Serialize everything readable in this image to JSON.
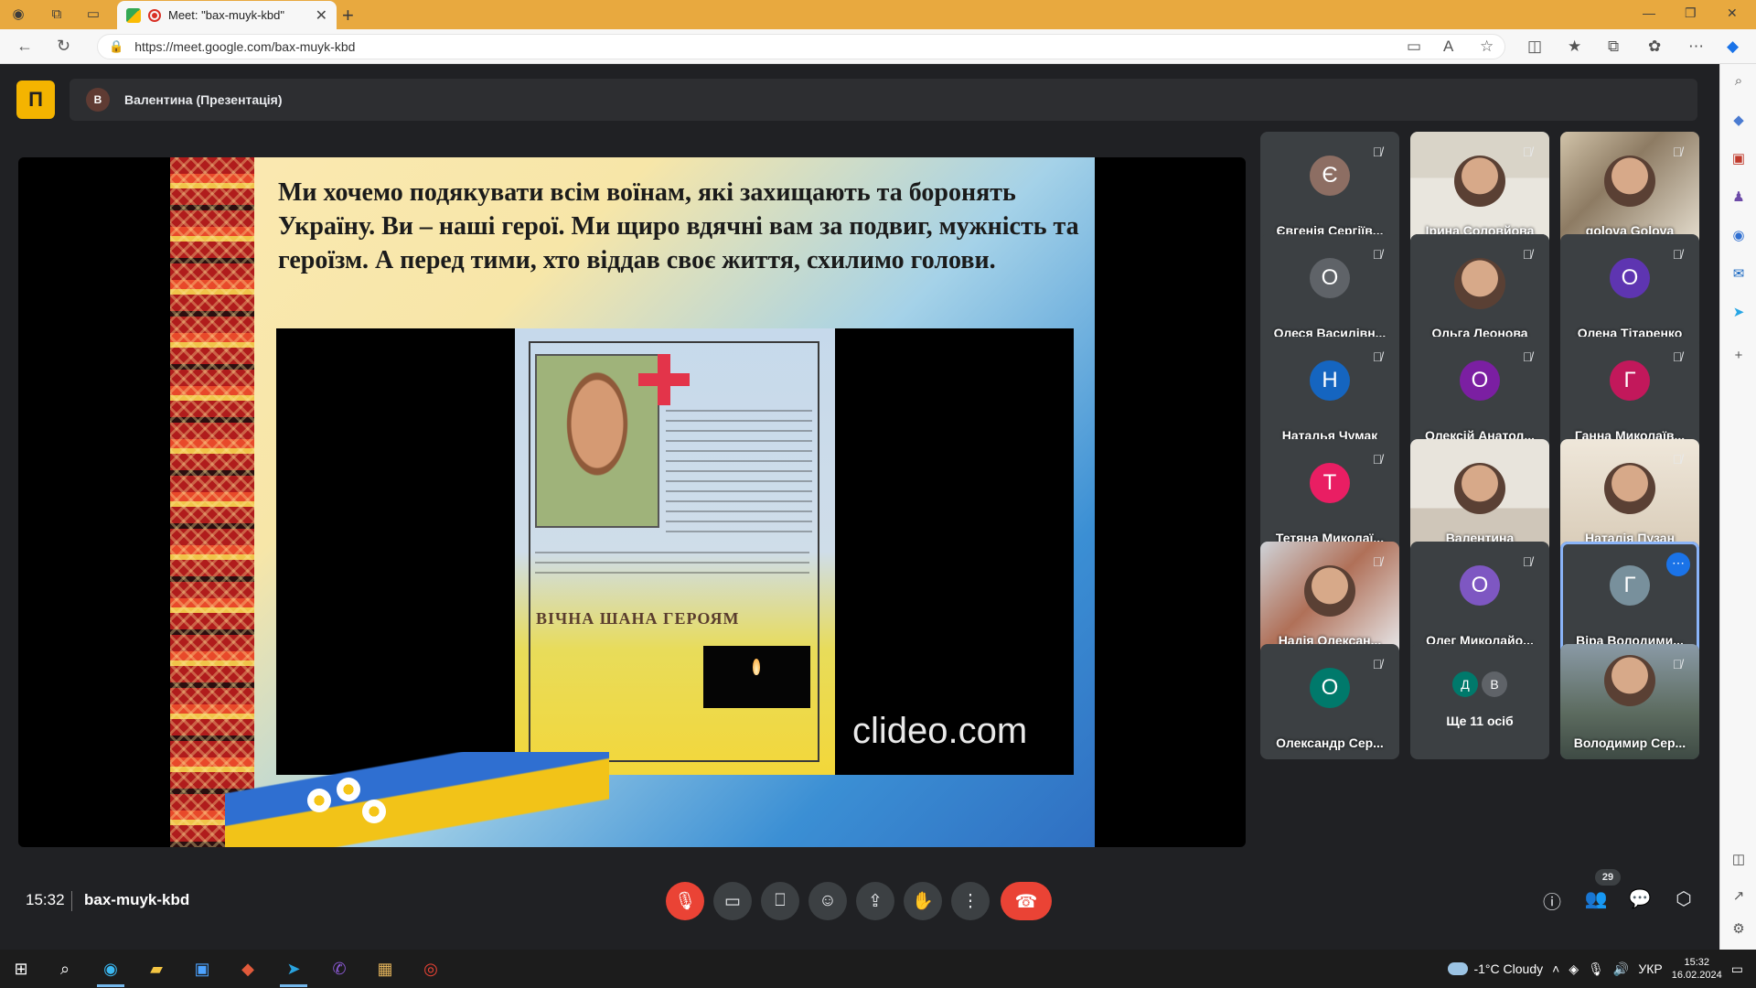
{
  "browser": {
    "tab_title": "Meet: \"bax-muyk-kbd\"",
    "url": "https://meet.google.com/bax-muyk-kbd"
  },
  "meet": {
    "presenter_initial": "В",
    "presenter_label": "Валентина (Презентація)",
    "slide": {
      "text": "Ми хочемо подякувати всім воїнам, які захищають та боронять Україну. Ви – наші герої. Ми щиро вдячні вам за подвиг, мужність та героїзм. А перед тими, хто віддав своє життя, схилимо голови.",
      "poster_heading": "ВІЧНА ШАНА ГЕРОЯМ",
      "watermark": "clideo.com"
    },
    "participants": [
      {
        "name": "Євгенія Сергіїв...",
        "initial": "Є",
        "color": "#8d6e63",
        "photo": false,
        "muted": true
      },
      {
        "name": "Ірина Соловйова",
        "initial": "",
        "color": "",
        "photo": true,
        "muted": true
      },
      {
        "name": "golova Golova",
        "initial": "",
        "color": "",
        "photo": true,
        "muted": true
      },
      {
        "name": "Олеся Василівн...",
        "initial": "О",
        "color": "#5f6368",
        "photo": false,
        "muted": true
      },
      {
        "name": "Ольга Леонова",
        "initial": "",
        "color": "",
        "photo": true,
        "muted": true
      },
      {
        "name": "Олена Тітаренко",
        "initial": "О",
        "color": "#5e35b1",
        "photo": false,
        "muted": true
      },
      {
        "name": "Наталья Чумак",
        "initial": "Н",
        "color": "#1565c0",
        "photo": false,
        "muted": true
      },
      {
        "name": "Олексій Анатол...",
        "initial": "О",
        "color": "#7b1fa2",
        "photo": false,
        "muted": true
      },
      {
        "name": "Ганна Миколаїв...",
        "initial": "Г",
        "color": "#c2185b",
        "photo": false,
        "muted": true
      },
      {
        "name": "Тетяна Миколаї...",
        "initial": "Т",
        "color": "#e91e63",
        "photo": false,
        "muted": true
      },
      {
        "name": "Валентина",
        "initial": "",
        "color": "",
        "photo": true,
        "muted": false
      },
      {
        "name": "Наталія Пузан",
        "initial": "",
        "color": "",
        "photo": true,
        "muted": true
      },
      {
        "name": "Надія Олексан...",
        "initial": "",
        "color": "",
        "photo": true,
        "muted": true
      },
      {
        "name": "Олег Миколайо...",
        "initial": "О",
        "color": "#7e57c2",
        "photo": false,
        "muted": true
      },
      {
        "name": "Віра Володими...",
        "initial": "Г",
        "color": "#78909c",
        "photo": false,
        "muted": false
      },
      {
        "name": "Олександр Сер...",
        "initial": "О",
        "color": "#00796b",
        "photo": false,
        "muted": true
      },
      {
        "name": "Ще 11 осіб",
        "initial": "",
        "color": "",
        "photo": false,
        "muted": false
      },
      {
        "name": "Володимир Сер...",
        "initial": "",
        "color": "",
        "photo": true,
        "muted": true
      }
    ],
    "more_initials": [
      "Д",
      "В"
    ],
    "time": "15:32",
    "meeting_code": "bax-muyk-kbd",
    "participant_count": "29"
  },
  "taskbar": {
    "weather": "-1°C  Cloudy",
    "lang": "УКР",
    "time": "15:32",
    "date": "16.02.2024"
  }
}
